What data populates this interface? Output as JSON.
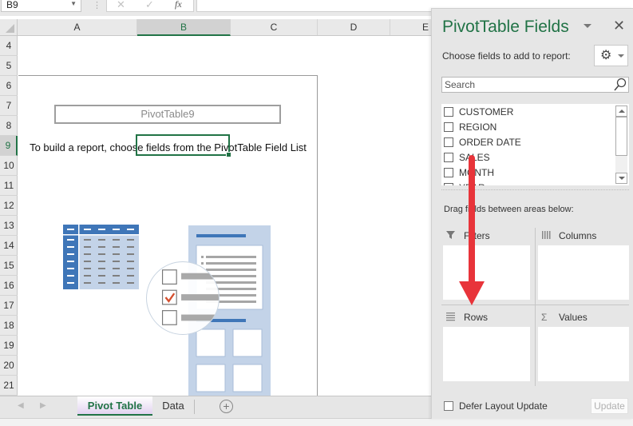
{
  "formula_bar": {
    "name_box": "B9",
    "cancel_icon": "✕",
    "enter_icon": "✓",
    "fx_label": "fx",
    "formula_value": ""
  },
  "columns": [
    {
      "label": "A",
      "selected": false
    },
    {
      "label": "B",
      "selected": true
    },
    {
      "label": "C",
      "selected": false
    },
    {
      "label": "D",
      "selected": false
    },
    {
      "label": "E",
      "selected": false
    }
  ],
  "rows": [
    "4",
    "5",
    "6",
    "7",
    "8",
    "9",
    "10",
    "11",
    "12",
    "13",
    "14",
    "15",
    "16",
    "17",
    "18",
    "19",
    "20",
    "21"
  ],
  "selected_row": "9",
  "sheet": {
    "pivot_name": "PivotTable9",
    "pivot_message": "To build a report, choose fields from the PivotTable Field List"
  },
  "sheet_tabs": {
    "tabs": [
      {
        "label": "Pivot Table",
        "active": true
      },
      {
        "label": "Data",
        "active": false
      }
    ],
    "add_sheet_icon": "⊕"
  },
  "pivot_pane": {
    "title": "PivotTable Fields",
    "close_icon": "✕",
    "choose_label": "Choose fields to add to report:",
    "gear_icon": "⚙",
    "search_placeholder": "Search",
    "search_value": "",
    "fields": [
      {
        "name": "CUSTOMER",
        "checked": false
      },
      {
        "name": "REGION",
        "checked": false
      },
      {
        "name": "ORDER DATE",
        "checked": false
      },
      {
        "name": "SALES",
        "checked": false
      },
      {
        "name": "MONTH",
        "checked": false
      },
      {
        "name": "YEAR",
        "checked": false
      }
    ],
    "drag_label": "Drag fields between areas below:",
    "areas": {
      "filters": {
        "label": "Filters",
        "icon": "filter-icon"
      },
      "columns": {
        "label": "Columns",
        "icon": "columns-icon"
      },
      "rows": {
        "label": "Rows",
        "icon": "rows-icon"
      },
      "values": {
        "label": "Values",
        "icon": "sigma-icon"
      }
    },
    "defer_label": "Defer Layout Update",
    "defer_checked": false,
    "update_label": "Update"
  },
  "annotation": {
    "arrow_color": "#e8343a",
    "description": "red arrow from field list to Rows area"
  },
  "colors": {
    "accent": "#217346",
    "illustration_blue": "#3f76b8",
    "illustration_light": "#c3d3e8",
    "check_red": "#d4502f"
  }
}
